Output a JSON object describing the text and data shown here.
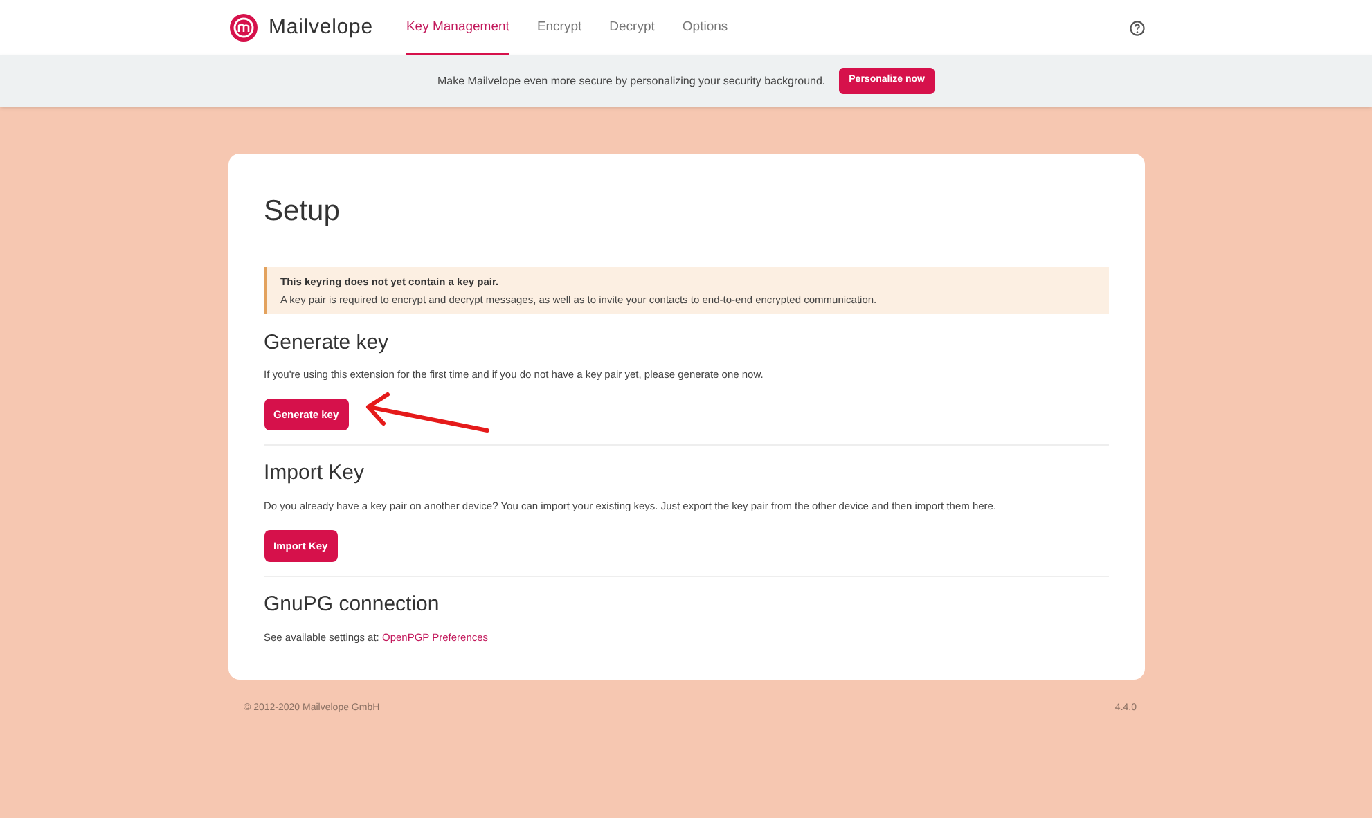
{
  "brand": "Mailvelope",
  "nav": [
    {
      "label": "Key Management",
      "selected": true
    },
    {
      "label": "Encrypt",
      "selected": false
    },
    {
      "label": "Decrypt",
      "selected": false
    },
    {
      "label": "Options",
      "selected": false
    }
  ],
  "banner": {
    "text": "Make Mailvelope even more secure by personalizing your security background.",
    "button": "Personalize now"
  },
  "card": {
    "title": "Setup",
    "alert": {
      "title": "This keyring does not yet contain a key pair.",
      "text": "A key pair is required to encrypt and decrypt messages, as well as to invite your contacts to end-to-end encrypted communication."
    },
    "sections": [
      {
        "heading": "Generate key",
        "text": "If you're using this extension for the first time and if you do not have a key pair yet, please generate one now.",
        "button": "Generate key"
      },
      {
        "heading": "Import Key",
        "text": "Do you already have a key pair on another device? You can import your existing keys. Just export the key pair from the other device and then import them here.",
        "button": "Import Key"
      },
      {
        "heading": "GnuPG connection",
        "text": "See available settings at: ",
        "link": "OpenPGP Preferences"
      }
    ]
  },
  "footer": {
    "copyright": "© 2012-2020  Mailvelope GmbH",
    "version": "4.4.0"
  }
}
